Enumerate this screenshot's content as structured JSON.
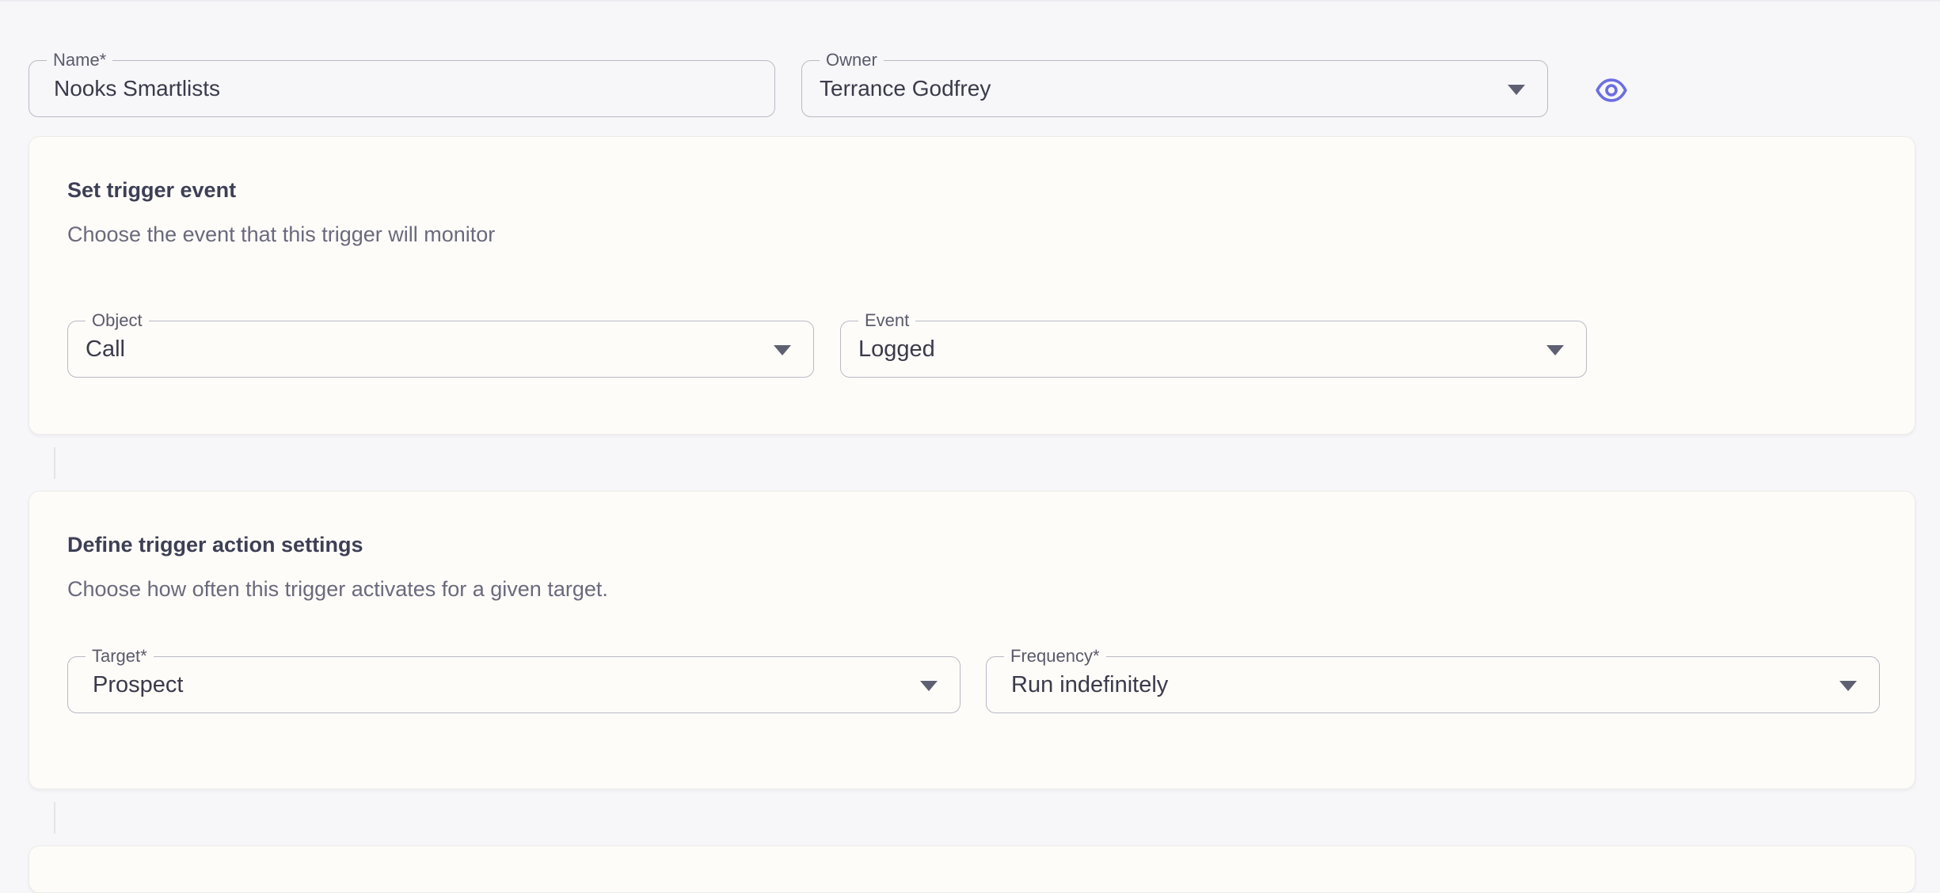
{
  "header": {
    "name_field": {
      "label": "Name*",
      "value": "Nooks Smartlists"
    },
    "owner_field": {
      "label": "Owner",
      "value": "Terrance Godfrey"
    },
    "preview_icon": "eye-icon"
  },
  "trigger_event": {
    "title": "Set trigger event",
    "description": "Choose the event that this trigger will monitor",
    "object_field": {
      "label": "Object",
      "value": "Call"
    },
    "event_field": {
      "label": "Event",
      "value": "Logged"
    }
  },
  "action_settings": {
    "title": "Define trigger action settings",
    "description": "Choose how often this trigger activates for a given target.",
    "target_field": {
      "label": "Target*",
      "value": "Prospect"
    },
    "frequency_field": {
      "label": "Frequency*",
      "value": "Run indefinitely"
    }
  },
  "colors": {
    "accent": "#6d6ee0",
    "page_background": "#f7f7fa",
    "card_background": "#fefcf9",
    "border": "#b9b9c4"
  }
}
